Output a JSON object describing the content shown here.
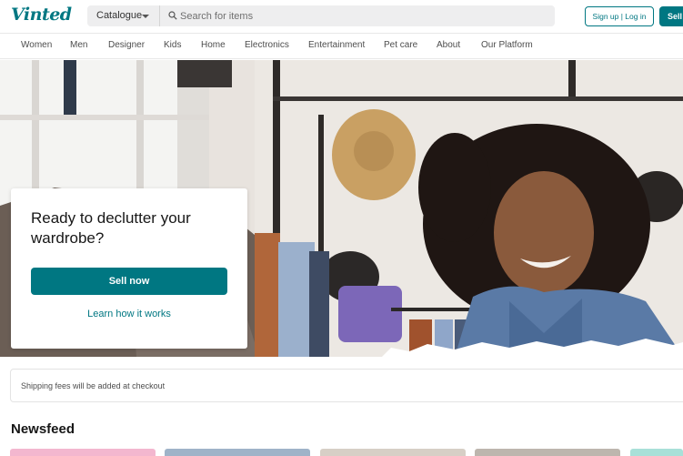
{
  "header": {
    "logo": "Vinted",
    "catalogue_label": "Catalogue",
    "search_placeholder": "Search for items",
    "signup_login_label": "Sign up | Log in",
    "sell_label": "Sell now",
    "brand_color": "#007782"
  },
  "nav": {
    "items": [
      "Women",
      "Men",
      "Designer",
      "Kids",
      "Home",
      "Electronics",
      "Entertainment",
      "Pet care",
      "About",
      "Our Platform"
    ]
  },
  "hero": {
    "title": "Ready to declutter your wardrobe?",
    "primary_button": "Sell now",
    "secondary_link": "Learn how it works"
  },
  "shipping_notice": "Shipping fees will be added at checkout",
  "newsfeed": {
    "title": "Newsfeed"
  }
}
